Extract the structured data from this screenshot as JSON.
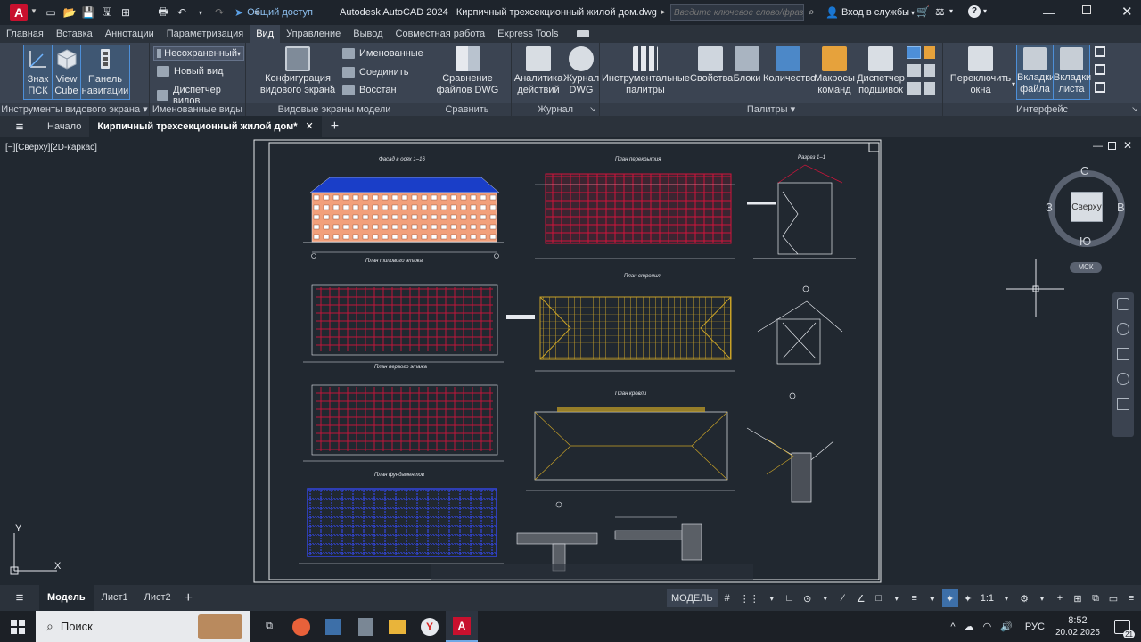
{
  "window": {
    "app_title": "Autodesk AutoCAD 2024",
    "file_title": "Кирпичный трехсекционный жилой дом.dwg",
    "share_label": "Общий доступ",
    "search_placeholder": "Введите ключевое слово/фразу",
    "signin_label": "Вход в службы"
  },
  "ribbon_tabs": [
    "Главная",
    "Вставка",
    "Аннотации",
    "Параметризация",
    "Вид",
    "Управление",
    "Вывод",
    "Совместная работа",
    "Express Tools"
  ],
  "active_ribbon_tab": "Вид",
  "ribbon": {
    "viewport_tools": {
      "title": "Инструменты видового экрана",
      "ucs_icon_label": "Знак ПСК",
      "viewcube_label": "View Cube",
      "navbar_label": "Панель навигации"
    },
    "named_views": {
      "title": "Именованные виды",
      "dropdown_value": "Несохраненный",
      "new_view": "Новый вид",
      "view_manager": "Диспетчер видов"
    },
    "model_viewports": {
      "title": "Видовые экраны модели",
      "config_label": "Конфигурация видового экрана",
      "named": "Именованные",
      "join": "Соединить",
      "restore": "Восстан"
    },
    "compare": {
      "title": "Сравнить",
      "dwg_compare": "Сравнение файлов DWG"
    },
    "history": {
      "title": "Журнал",
      "activity": "Аналитика действий",
      "dwg_history": "Журнал DWG"
    },
    "palettes": {
      "title": "Палитры",
      "tool_palettes": "Инструментальные палитры",
      "properties": "Свойства",
      "blocks": "Блоки",
      "count": "Количество",
      "macros": "Макросы команд",
      "sheet_set": "Диспетчер подшивок"
    },
    "interface": {
      "title": "Интерфейс",
      "switch_windows": "Переключить окна",
      "file_tabs": "Вкладки файла",
      "layout_tabs": "Вкладки листа"
    }
  },
  "file_tabs": {
    "start": "Начало",
    "current": "Кирпичный трехсекционный жилой дом*"
  },
  "viewport": {
    "label": "[−][Сверху][2D-каркас]",
    "viewcube": {
      "face": "Сверху",
      "north": "С",
      "south": "Ю",
      "west": "З",
      "east": "В",
      "wcs": "МСК"
    },
    "ucs": {
      "x": "X",
      "y": "Y"
    },
    "drawing_titles": {
      "facade": "Фасад в осях 1–16",
      "floor_plan_typical": "План типового этажа",
      "floor_plan_first": "План первого этажа",
      "foundation_plan": "План фундаментов",
      "slab_plan": "План перекрытия",
      "rafter_plan": "План стропил",
      "roof_plan": "План кровли",
      "section": "Разрез 1–1"
    }
  },
  "layout_tabs": [
    "Модель",
    "Лист1",
    "Лист2"
  ],
  "status": {
    "model_label": "МОДЕЛЬ",
    "scale": "1:1"
  },
  "taskbar": {
    "search_placeholder": "Поиск",
    "lang": "РУС",
    "time": "8:52",
    "date": "20.02.2025",
    "notifications": "21"
  },
  "colors": {
    "accent": "#3d6fa8",
    "autocad_red": "#c8102e",
    "viewport_bg": "#212830"
  }
}
